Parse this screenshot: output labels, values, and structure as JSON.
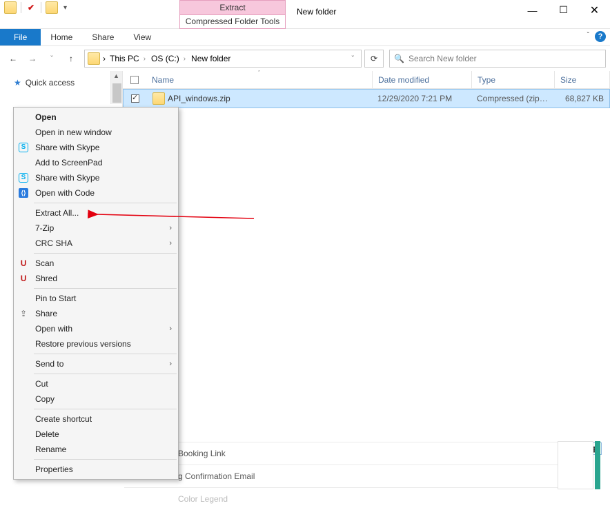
{
  "titlebar": {
    "contextual_tab_top": "Extract",
    "contextual_tab_bottom": "Compressed Folder Tools",
    "window_title": "New folder"
  },
  "window_buttons": {
    "min": "—",
    "max": "☐",
    "close": "✕"
  },
  "ribbon": {
    "file": "File",
    "tabs": [
      "Home",
      "Share",
      "View"
    ]
  },
  "nav": {
    "back": "←",
    "forward": "→",
    "up": "↑",
    "refresh": "⟳"
  },
  "breadcrumbs": [
    "This PC",
    "OS (C:)",
    "New folder"
  ],
  "search": {
    "placeholder": "Search New folder"
  },
  "navpane": {
    "quick_access": "Quick access"
  },
  "columns": {
    "name": "Name",
    "date": "Date modified",
    "type": "Type",
    "size": "Size"
  },
  "rows": [
    {
      "name": "API_windows.zip",
      "date": "12/29/2020 7:21 PM",
      "type": "Compressed (zipp...",
      "size": "68,827 KB"
    }
  ],
  "context_menu": {
    "open": "Open",
    "open_new_window": "Open in new window",
    "share_skype1": "Share with Skype",
    "add_screenpad": "Add to ScreenPad",
    "share_skype2": "Share with Skype",
    "open_code": "Open with Code",
    "extract_all": "Extract All...",
    "seven_zip": "7-Zip",
    "crc_sha": "CRC SHA",
    "scan": "Scan",
    "shred": "Shred",
    "pin_start": "Pin to Start",
    "share": "Share",
    "open_with": "Open with",
    "restore": "Restore previous versions",
    "send_to": "Send to",
    "cut": "Cut",
    "copy": "Copy",
    "shortcut": "Create shortcut",
    "delete": "Delete",
    "rename": "Rename",
    "properties": "Properties"
  },
  "bg_partial": {
    "row1": "Booking Link",
    "row2": "g Confirmation Email",
    "row3": "Color Legend"
  }
}
